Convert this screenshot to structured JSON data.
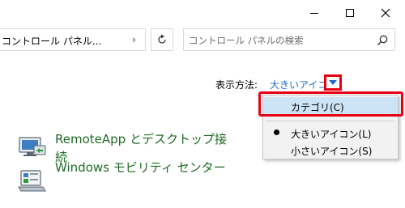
{
  "window": {
    "minimize_label": "Minimize",
    "maximize_label": "Maximize",
    "close_label": "Close"
  },
  "address": {
    "path": "コントロール パネル...",
    "chevron": "›"
  },
  "search": {
    "placeholder": "コントロール パネルの検索"
  },
  "view_by": {
    "label": "表示方法:",
    "value": "大きいアイコン"
  },
  "menu": {
    "items": [
      {
        "label": "カテゴリ(C)",
        "selected": false,
        "highlighted": true
      },
      {
        "label": "大きいアイコン(L)",
        "selected": true,
        "highlighted": false
      },
      {
        "label": "小さいアイコン(S)",
        "selected": false,
        "highlighted": false
      }
    ]
  },
  "items": [
    {
      "label_line1": "RemoteApp とデスクトップ接",
      "label_line2": "続",
      "icon": "remoteapp-icon"
    },
    {
      "label": "Windows モビリティ センター",
      "icon": "mobility-center-icon"
    }
  ],
  "colors": {
    "link_green": "#1f6b24",
    "link_blue": "#1e6fc8",
    "highlight_red": "#e60012",
    "menu_hover": "#cde4f7"
  }
}
